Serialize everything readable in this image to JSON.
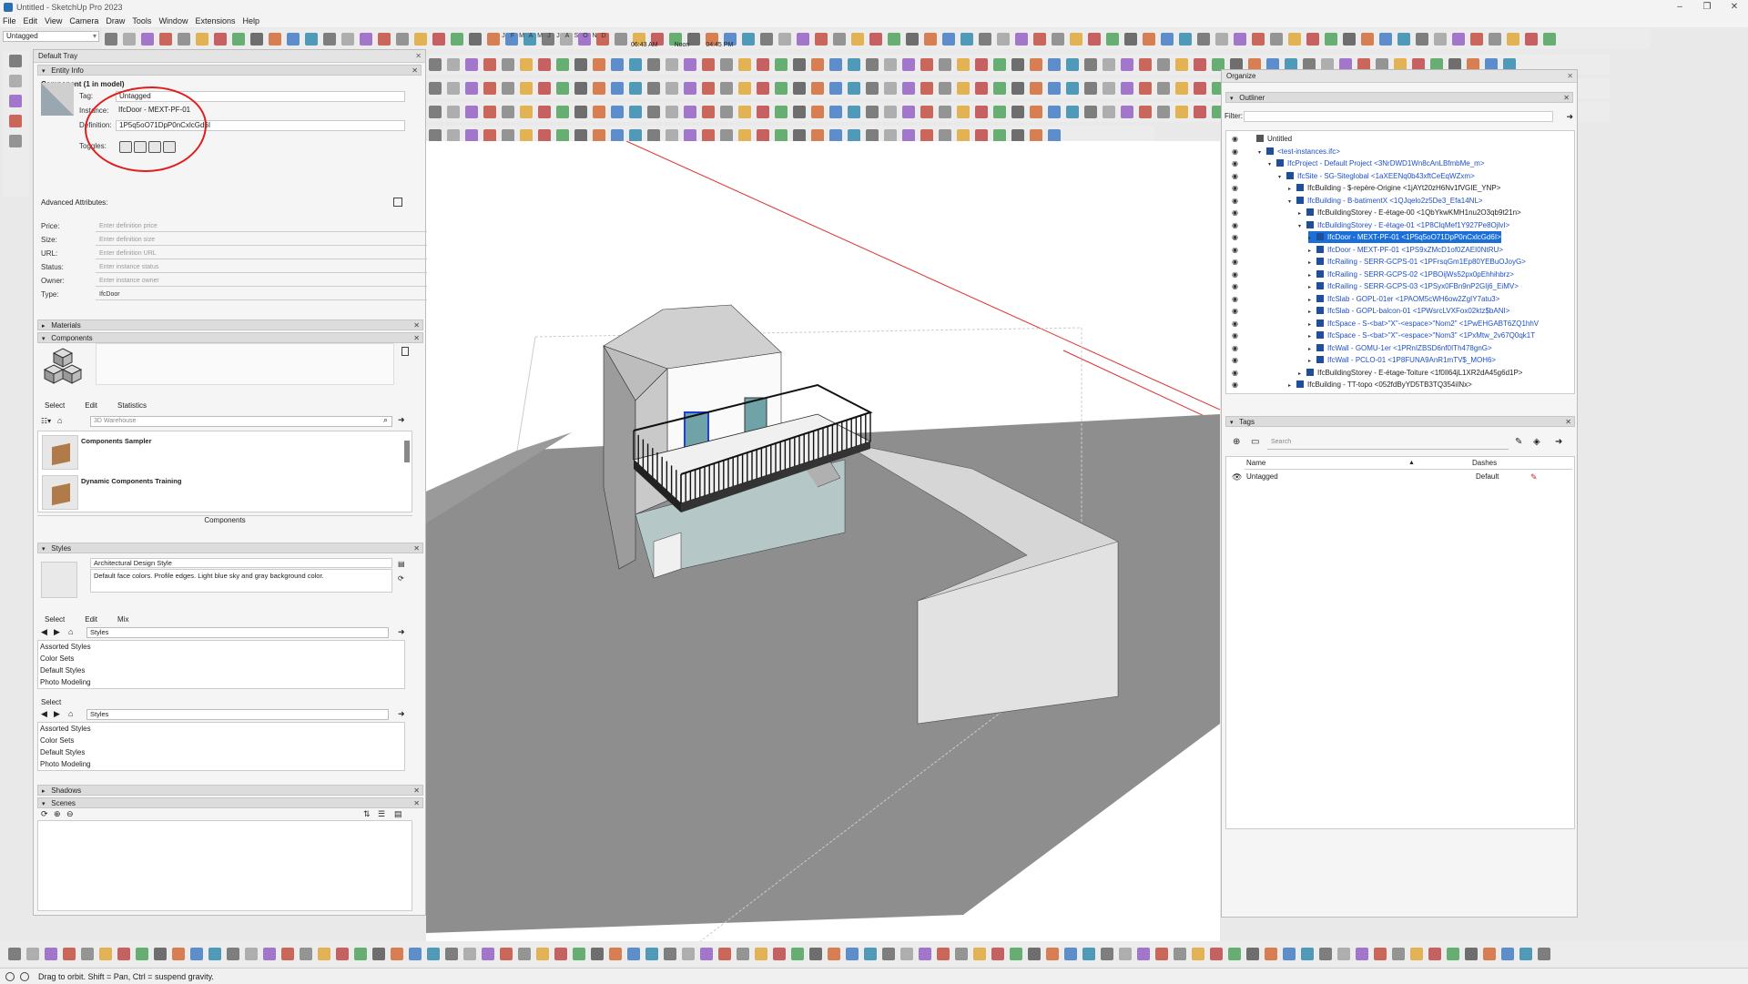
{
  "window": {
    "title": "Untitled - SketchUp Pro 2023",
    "controls": [
      "–",
      "❐",
      "✕"
    ]
  },
  "menu": [
    "File",
    "Edit",
    "View",
    "Camera",
    "Draw",
    "Tools",
    "Window",
    "Extensions",
    "Help"
  ],
  "toolbar": {
    "tag_dropdown": "Untagged",
    "shadow": {
      "months": [
        "J",
        "F",
        "M",
        "A",
        "M",
        "J",
        "J",
        "A",
        "S",
        "O",
        "N",
        "D"
      ],
      "time_start": "06:43 AM",
      "time_mid": "Noon",
      "time_end": "04:45 PM"
    }
  },
  "tray": {
    "title": "Default Tray",
    "entity_info": {
      "header": "Entity Info",
      "component_title": "Component (1 in model)",
      "tag_label": "Tag:",
      "tag_value": "Untagged",
      "instance_label": "Instance:",
      "instance_value": "IfcDoor - MEXT-PF-01",
      "definition_label": "Definition:",
      "definition_value": "1P5q5oO71DpP0nCxlcGd6I",
      "toggles_label": "Toggles:",
      "advanced_label": "Advanced Attributes:",
      "attributes": [
        {
          "label": "Price:",
          "placeholder": "Enter definition price"
        },
        {
          "label": "Size:",
          "placeholder": "Enter definition size"
        },
        {
          "label": "URL:",
          "placeholder": "Enter definition URL"
        },
        {
          "label": "Status:",
          "placeholder": "Enter instance status"
        },
        {
          "label": "Owner:",
          "placeholder": "Enter instance owner"
        },
        {
          "label": "Type:",
          "placeholder": "IfcDoor"
        }
      ]
    },
    "materials": {
      "header": "Materials"
    },
    "components": {
      "header": "Components",
      "tabs": [
        "Select",
        "Edit",
        "Statistics"
      ],
      "search_placeholder": "3D Warehouse",
      "items": [
        "Components Sampler",
        "Dynamic Components Training"
      ],
      "footer": "Components"
    },
    "styles": {
      "header": "Styles",
      "style_name": "Architectural Design Style",
      "style_desc": "Default face colors. Profile edges. Light blue sky and gray background color.",
      "tabs": [
        "Select",
        "Edit",
        "Mix"
      ],
      "nav_select": "Styles",
      "list": [
        "Assorted Styles",
        "Color Sets",
        "Default Styles",
        "Photo Modeling"
      ],
      "select_label": "Select",
      "nav_select2": "Styles",
      "list2": [
        "Assorted Styles",
        "Color Sets",
        "Default Styles",
        "Photo Modeling"
      ]
    },
    "shadows": {
      "header": "Shadows"
    },
    "scenes": {
      "header": "Scenes"
    }
  },
  "organize": {
    "title": "Organize",
    "outliner_header": "Outliner",
    "filter_label": "Filter:",
    "tree": [
      {
        "level": 0,
        "text": "Untitled",
        "color": "black",
        "exp": ""
      },
      {
        "level": 1,
        "text": "<test-instances.ifc>",
        "color": "blue",
        "exp": "▾"
      },
      {
        "level": 2,
        "text": "IfcProject - Default Project <3NrDWD1Wn8cAnLBfmbMe_m>",
        "color": "blue",
        "exp": "▾"
      },
      {
        "level": 3,
        "text": "IfcSite - SG-Siteglobal <1aXEENq0b43xftCeEqWZxm>",
        "color": "blue",
        "exp": "▾"
      },
      {
        "level": 4,
        "text": "IfcBuilding - $-repère-Origine <1jAYt20zH6Nv1fVGIE_YNP>",
        "color": "black",
        "exp": "▸"
      },
      {
        "level": 4,
        "text": "IfcBuilding - B-batimentX <1QJqelo2z5De3_Efa14NL>",
        "color": "blue",
        "exp": "▾"
      },
      {
        "level": 5,
        "text": "IfcBuildingStorey - E-étage-00 <1QbYkwKMH1nu2O3qb9t21n>",
        "color": "black",
        "exp": "▸"
      },
      {
        "level": 5,
        "text": "IfcBuildingStorey - E-étage-01 <1P8ClqMef1Y927Pe8OjlvI>",
        "color": "blue",
        "exp": "▾"
      },
      {
        "level": 6,
        "text": "IfcDoor - MEXT-PF-01 <1P5q5oO71DpP0nCxlcGd6I>",
        "color": "selected",
        "exp": "▸"
      },
      {
        "level": 6,
        "text": "IfcDoor - MEXT-PF-01 <1PS9xZMcD1of0ZAEI0NtRU>",
        "color": "blue",
        "exp": "▸"
      },
      {
        "level": 6,
        "text": "IfcRailing - SERR-GCPS-01 <1PFrsqGm1Ep80YEBuOJoyG>",
        "color": "blue",
        "exp": "▸"
      },
      {
        "level": 6,
        "text": "IfcRailing - SERR-GCPS-02 <1PBOijWs52px0pEhhihbrz>",
        "color": "blue",
        "exp": "▸"
      },
      {
        "level": 6,
        "text": "IfcRailing - SERR-GCPS-03 <1PSyx0FBn9nP2GIj6_EiMV>",
        "color": "blue",
        "exp": "▸"
      },
      {
        "level": 6,
        "text": "IfcSlab - GOPL-01er <1PAOM5cWH6ow2ZgIY7atu3>",
        "color": "blue",
        "exp": "▸"
      },
      {
        "level": 6,
        "text": "IfcSlab - GOPL-balcon-01 <1PWsrcLVXFox02ktz$bANI>",
        "color": "blue",
        "exp": "▸"
      },
      {
        "level": 6,
        "text": "IfcSpace - S-<bat>\"X\"-<espace>\"Nom2\" <1PwEHGABT6ZQ1hhV",
        "color": "blue",
        "exp": "▸"
      },
      {
        "level": 6,
        "text": "IfcSpace - S-<bat>\"X\"-<espace>\"Nom3\" <1PxMtw_2v67Q0qk1T",
        "color": "blue",
        "exp": "▸"
      },
      {
        "level": 6,
        "text": "IfcWall - GOMU-1er <1PRnIZBSD6nf0ITh478gnG>",
        "color": "blue",
        "exp": "▸"
      },
      {
        "level": 6,
        "text": "IfcWall - PCLO-01 <1P8FUNA9AnR1mTV$_MOH6>",
        "color": "blue",
        "exp": "▸"
      },
      {
        "level": 5,
        "text": "IfcBuildingStorey - E-étage-Toiture <1f0Il64jL1XR2dA45g6d1P>",
        "color": "black",
        "exp": "▸"
      },
      {
        "level": 4,
        "text": "IfcBuilding - TT-topo <052fdByYD5TB3TQ354iINx>",
        "color": "black",
        "exp": "▸"
      }
    ],
    "tags_header": "Tags",
    "tags_search_placeholder": "Search",
    "tags_columns": [
      "Name",
      "Dashes"
    ],
    "tags_rows": [
      {
        "name": "Untagged",
        "dashes": "Default"
      }
    ]
  },
  "status": {
    "message": "Drag to orbit. Shift = Pan, Ctrl = suspend gravity."
  },
  "colors": {
    "selection": "#1a6fd8",
    "annotation": "#e21d1d",
    "axis_red": "#d33"
  }
}
